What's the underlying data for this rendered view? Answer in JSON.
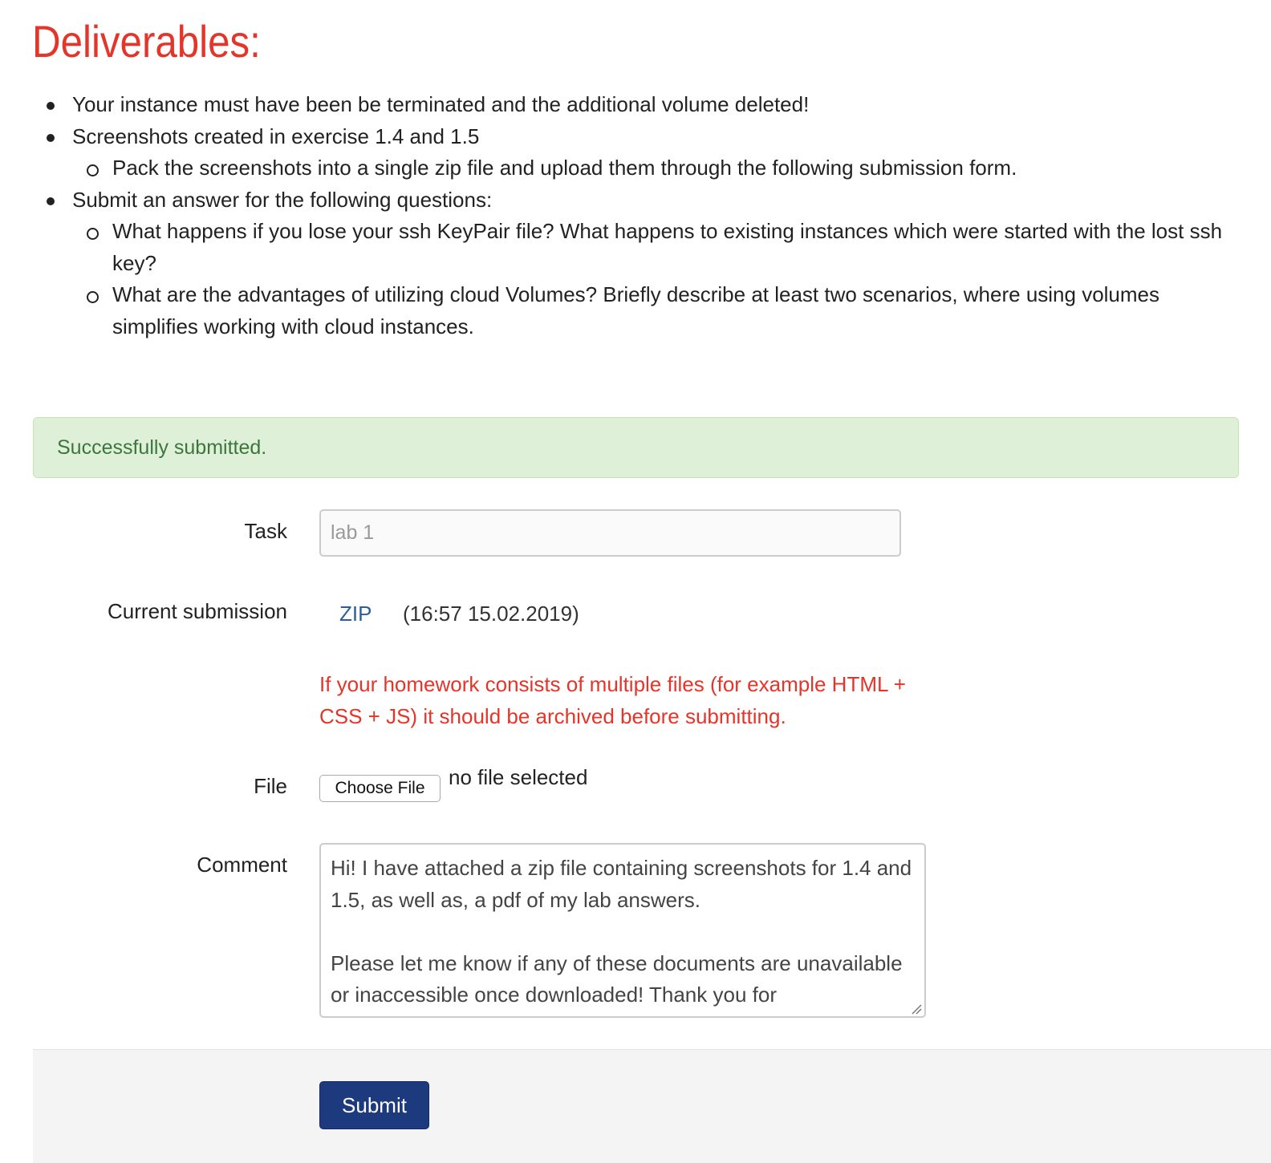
{
  "title": "Deliverables:",
  "deliverables": [
    {
      "text": "Your instance must have been be terminated and the additional volume deleted!",
      "children": []
    },
    {
      "text": "Screenshots created in exercise 1.4 and 1.5",
      "children": [
        "Pack the screenshots into a single zip file and upload them through the following submission form."
      ]
    },
    {
      "text": "Submit an answer for the following questions:",
      "children": [
        "What happens if you lose your ssh KeyPair file? What happens to existing instances which were started with the lost ssh key?",
        "What are the advantages of utilizing cloud Volumes? Briefly describe at least two scenarios, where using volumes simplifies working with cloud instances."
      ]
    }
  ],
  "alert": {
    "text": "Successfully submitted."
  },
  "form": {
    "task_label": "Task",
    "task_value": "lab 1",
    "current_submission_label": "Current submission",
    "submission_link": "ZIP",
    "submission_date": "(16:57 15.02.2019)",
    "warning": "If your homework consists of multiple files (for example HTML + CSS + JS) it should be archived before submitting.",
    "file_label": "File",
    "file_button": "Choose File",
    "file_status": "no file selected",
    "comment_label": "Comment",
    "comment_value": "Hi! I have attached a zip file containing screenshots for 1.4 and 1.5, as well as, a pdf of my lab answers.\n\nPlease let me know if any of these documents are unavailable or inaccessible once downloaded! Thank you for",
    "submit_label": "Submit"
  },
  "colors": {
    "title": "#e4352a",
    "alert_bg": "#dff0d8",
    "alert_text": "#3c763d",
    "link": "#2d5f96",
    "warning": "#e4352a",
    "submit_bg": "#1d3a7e"
  }
}
